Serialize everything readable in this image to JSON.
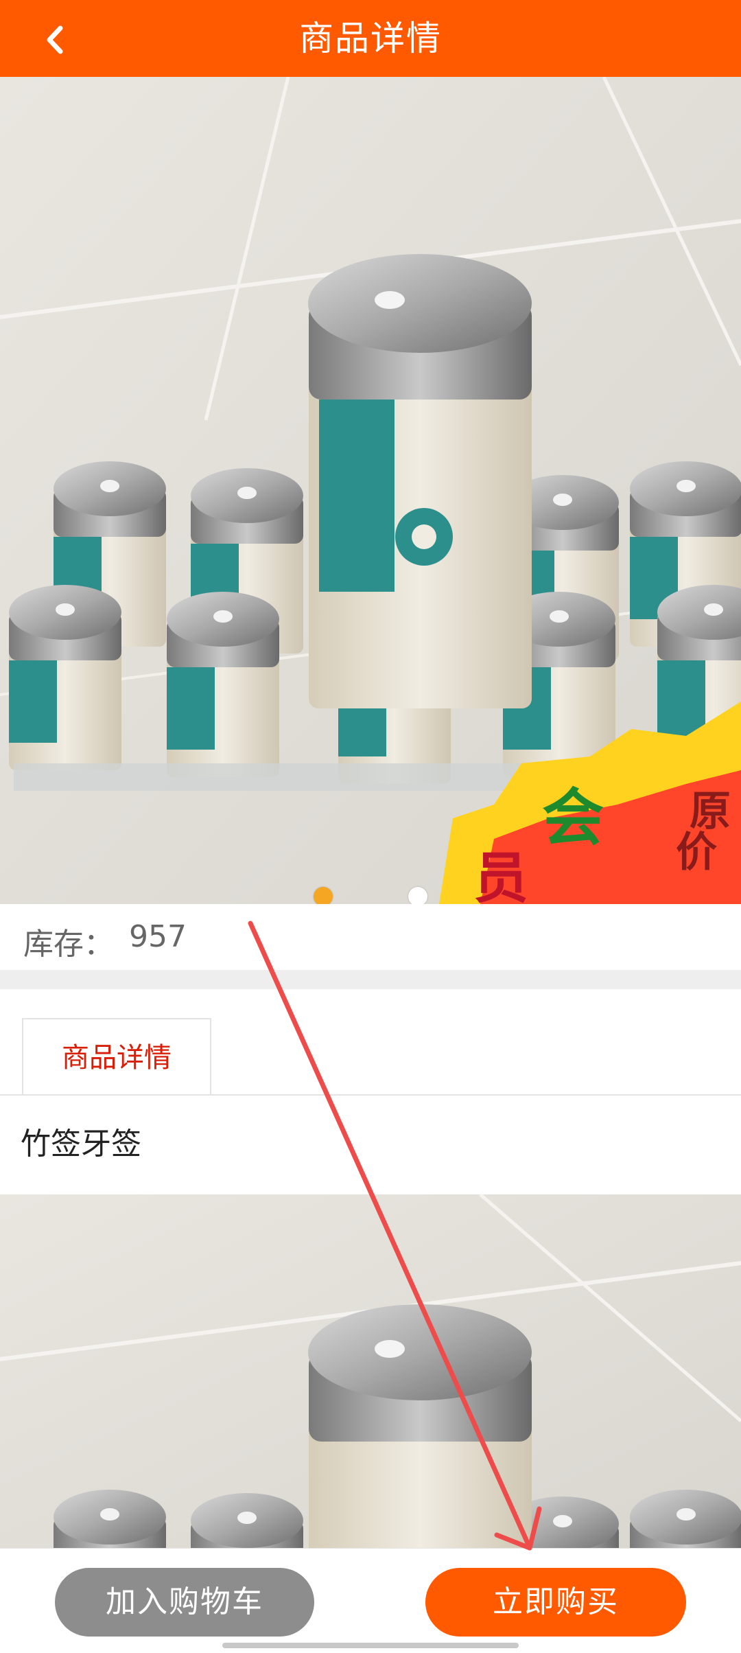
{
  "header": {
    "title": "商品详情",
    "back_icon": "chevron-left-icon",
    "background_color": "#ff5a00"
  },
  "carousel": {
    "total_slides": 2,
    "active_index": 0,
    "active_dot_color": "#f5a623",
    "inactive_dot_color": "#ffffff"
  },
  "stock": {
    "label": "库存：",
    "value": "957"
  },
  "tabs": {
    "active_label": "商品详情",
    "active_color": "#d81e06"
  },
  "description": {
    "text": "竹签牙签"
  },
  "bottom_bar": {
    "add_to_cart_label": "加入购物车",
    "buy_now_label": "立即购买",
    "cart_color": "#8d8d8d",
    "buy_color": "#ff5a00"
  },
  "annotation": {
    "arrow_color": "#ee4b4b"
  }
}
